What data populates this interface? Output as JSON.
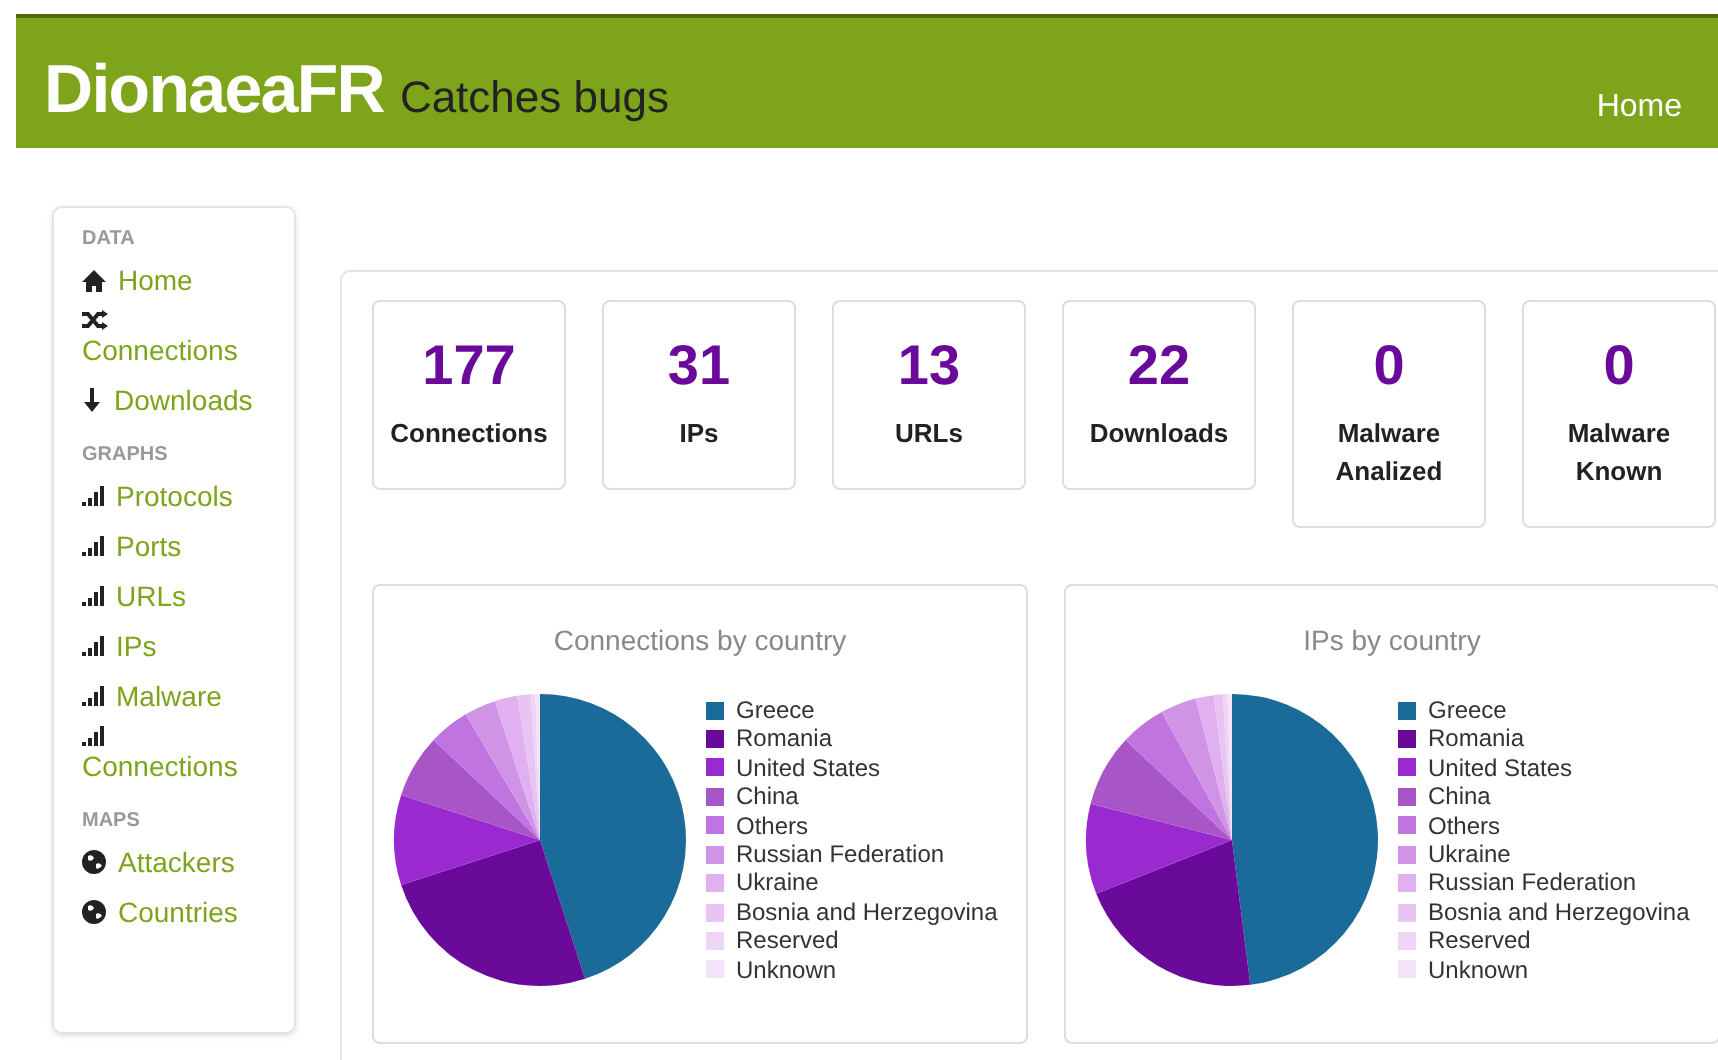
{
  "header": {
    "brand": "DionaeaFR",
    "tagline": "Catches bugs",
    "nav": [
      {
        "label": "Home"
      }
    ]
  },
  "sidebar": {
    "sections": [
      {
        "heading": "DATA",
        "items": [
          {
            "label": "Home",
            "kind": "home"
          },
          {
            "label": "Connections",
            "kind": "shuffle"
          },
          {
            "label": "Downloads",
            "kind": "download"
          }
        ]
      },
      {
        "heading": "GRAPHS",
        "items": [
          {
            "label": "Protocols",
            "kind": "signal"
          },
          {
            "label": "Ports",
            "kind": "signal"
          },
          {
            "label": "URLs",
            "kind": "signal"
          },
          {
            "label": "IPs",
            "kind": "signal"
          },
          {
            "label": "Malware",
            "kind": "signal"
          },
          {
            "label": "Connections",
            "kind": "signal"
          }
        ]
      },
      {
        "heading": "MAPS",
        "items": [
          {
            "label": "Attackers",
            "kind": "globe"
          },
          {
            "label": "Countries",
            "kind": "globe"
          }
        ]
      }
    ]
  },
  "stats": [
    {
      "value": "177",
      "label": "Connections"
    },
    {
      "value": "31",
      "label": "IPs"
    },
    {
      "value": "13",
      "label": "URLs"
    },
    {
      "value": "22",
      "label": "Downloads"
    },
    {
      "value": "0",
      "label": "Malware Analized"
    },
    {
      "value": "0",
      "label": "Malware Known"
    }
  ],
  "charts": [
    {
      "title": "Connections by country",
      "legend": [
        {
          "name": "Greece",
          "color": "#1a6a9a"
        },
        {
          "name": "Romania",
          "color": "#6a0a9a"
        },
        {
          "name": "United States",
          "color": "#9a2ad0"
        },
        {
          "name": "China",
          "color": "#a855c8"
        },
        {
          "name": "Others",
          "color": "#c074e0"
        },
        {
          "name": "Russian Federation",
          "color": "#d094e6"
        },
        {
          "name": "Ukraine",
          "color": "#e0b0f0"
        },
        {
          "name": "Bosnia and Herzegovina",
          "color": "#e8c4f2"
        },
        {
          "name": "Reserved",
          "color": "#f0d4f6"
        },
        {
          "name": "Unknown",
          "color": "#f5e4f9"
        }
      ]
    },
    {
      "title": "IPs by country",
      "legend": [
        {
          "name": "Greece",
          "color": "#1a6a9a"
        },
        {
          "name": "Romania",
          "color": "#6a0a9a"
        },
        {
          "name": "United States",
          "color": "#9a2ad0"
        },
        {
          "name": "China",
          "color": "#a855c8"
        },
        {
          "name": "Others",
          "color": "#c074e0"
        },
        {
          "name": "Ukraine",
          "color": "#d094e6"
        },
        {
          "name": "Russian Federation",
          "color": "#e0b0f0"
        },
        {
          "name": "Bosnia and Herzegovina",
          "color": "#e8c4f2"
        },
        {
          "name": "Reserved",
          "color": "#f0d4f6"
        },
        {
          "name": "Unknown",
          "color": "#f5e4f9"
        }
      ]
    }
  ]
}
